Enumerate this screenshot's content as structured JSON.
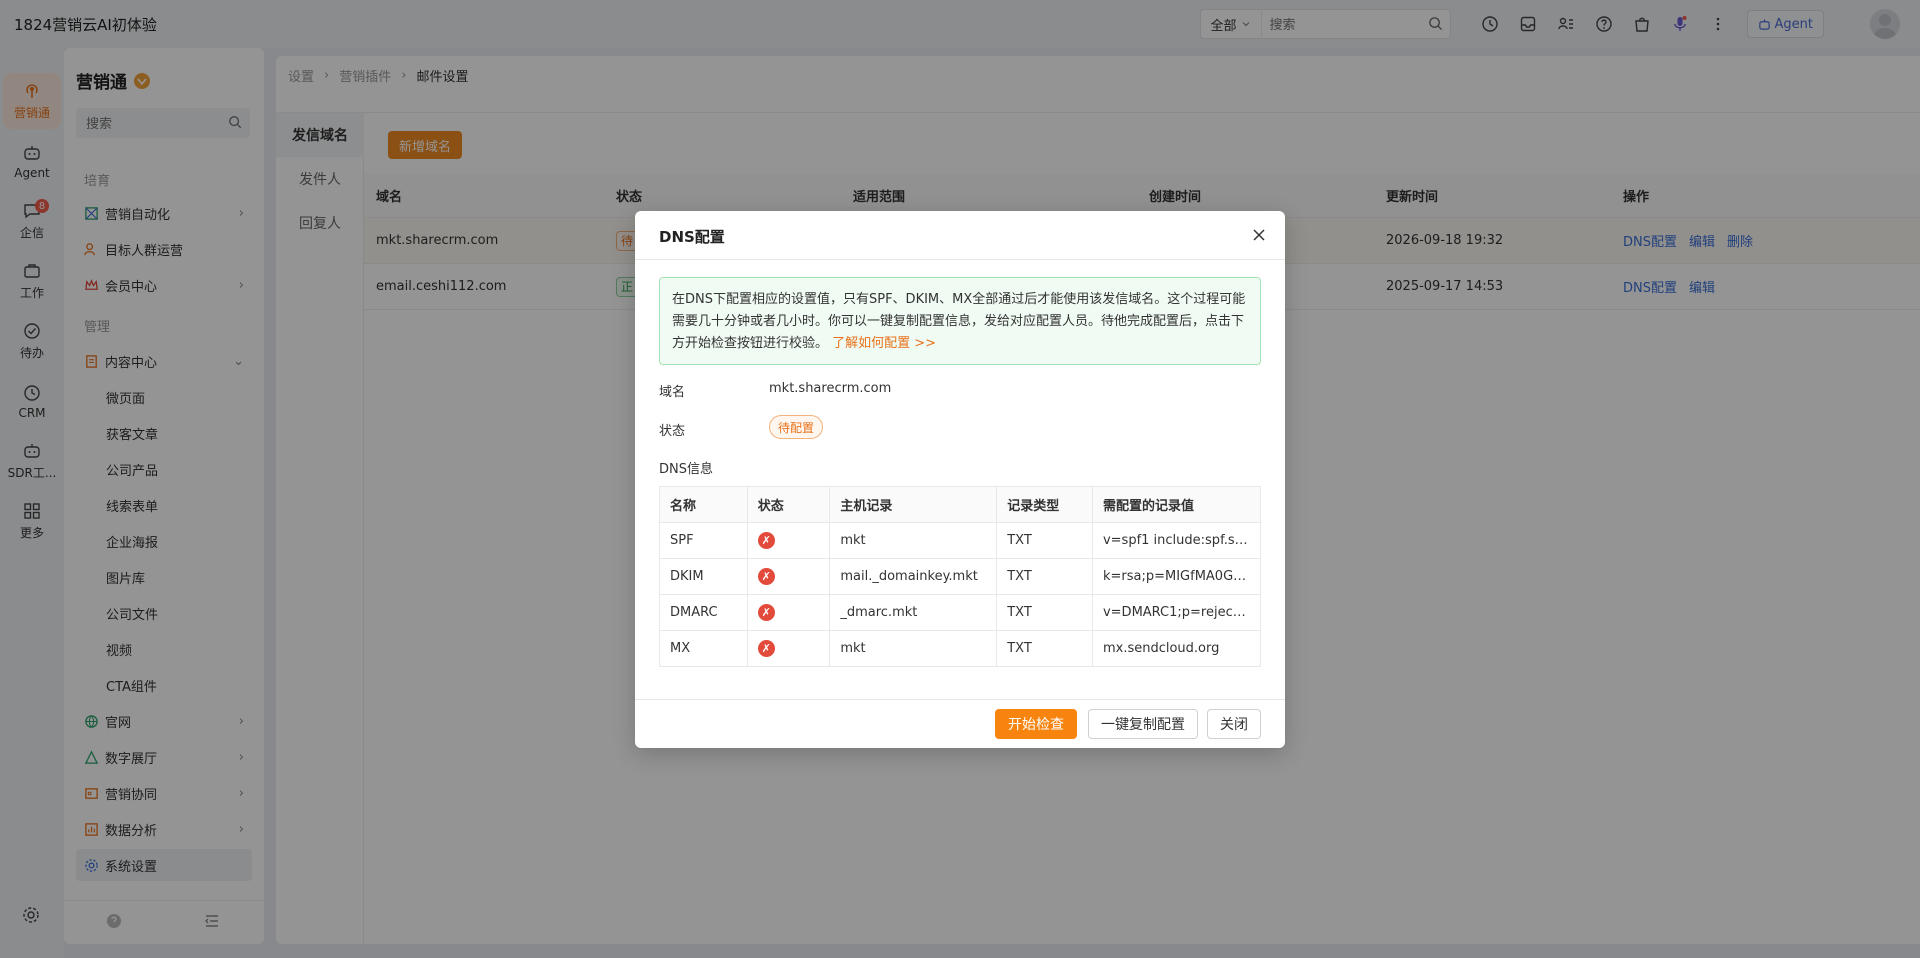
{
  "app": {
    "title": "1824营销云AI初体验"
  },
  "topbar": {
    "scope": "全部",
    "search_placeholder": "搜索",
    "agent_label": "Agent"
  },
  "rail": [
    {
      "label": "营销通",
      "icon": "broadcast-icon"
    },
    {
      "label": "Agent",
      "icon": "robot-icon"
    },
    {
      "label": "企信",
      "icon": "chat-icon",
      "badge": "8"
    },
    {
      "label": "工作",
      "icon": "briefcase-icon"
    },
    {
      "label": "待办",
      "icon": "check-circle-icon"
    },
    {
      "label": "CRM",
      "icon": "clock-icon"
    },
    {
      "label": "SDR工...",
      "icon": "robot-icon"
    },
    {
      "label": "更多",
      "icon": "grid-icon"
    }
  ],
  "sidemenu": {
    "title": "营销通",
    "search_placeholder": "搜索",
    "section_cultivate": "培育",
    "section_manage": "管理",
    "items": [
      "营销自动化",
      "目标人群运营",
      "会员中心",
      "内容中心",
      "微页面",
      "获客文章",
      "公司产品",
      "线索表单",
      "企业海报",
      "图片库",
      "公司文件",
      "视频",
      "CTA组件",
      "官网",
      "数字展厅",
      "营销协同",
      "数据分析",
      "系统设置"
    ]
  },
  "breadcrumb": [
    "设置",
    "营销插件",
    "邮件设置"
  ],
  "vtabs": [
    "发信域名",
    "发件人",
    "回复人"
  ],
  "add_domain_label": "新增域名",
  "domain_table": {
    "headers": [
      "域名",
      "状态",
      "适用范围",
      "创建时间",
      "更新时间",
      "操作"
    ],
    "rows": [
      {
        "domain": "mkt.sharecrm.com",
        "status": "待",
        "updated": "2026-09-18 19:32",
        "actions": [
          "DNS配置",
          "编辑",
          "删除"
        ]
      },
      {
        "domain": "email.ceshi112.com",
        "status": "正",
        "updated": "2025-09-17 14:53",
        "actions": [
          "DNS配置",
          "编辑"
        ]
      }
    ]
  },
  "modal": {
    "title": "DNS配置",
    "notice": "在DNS下配置相应的设置值，只有SPF、DKIM、MX全部通过后才能使用该发信域名。这个过程可能需要几十分钟或者几小时。你可以一键复制配置信息，发给对应配置人员。待他完成配置后，点击下方开始检查按钮进行校验。",
    "learn_link": "了解如何配置 >>",
    "domain_label": "域名",
    "domain_value": "mkt.sharecrm.com",
    "status_label": "状态",
    "status_value": "待配置",
    "dns_info_label": "DNS信息",
    "dns_headers": [
      "名称",
      "状态",
      "主机记录",
      "记录类型",
      "需配置的记录值"
    ],
    "dns_rows": [
      {
        "name": "SPF",
        "host": "mkt",
        "type": "TXT",
        "value": "v=spf1 include:spf.se..."
      },
      {
        "name": "DKIM",
        "host": "mail._domainkey.mkt",
        "type": "TXT",
        "value": "k=rsa;p=MIGfMA0GC..."
      },
      {
        "name": "DMARC",
        "host": "_dmarc.mkt",
        "type": "TXT",
        "value": "v=DMARC1;p=reject;r..."
      },
      {
        "name": "MX",
        "host": "mkt",
        "type": "TXT",
        "value": "mx.sendcloud.org"
      }
    ],
    "status_mark": "✗",
    "btn_check": "开始检查",
    "btn_copy": "一键复制配置",
    "btn_close": "关闭"
  }
}
